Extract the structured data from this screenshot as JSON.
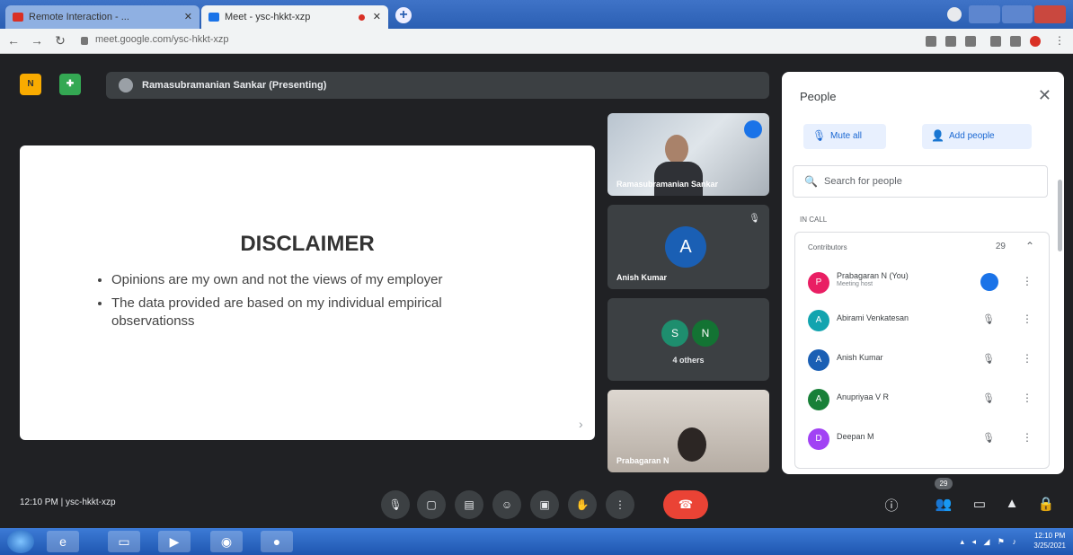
{
  "browser": {
    "tabs": [
      {
        "label": "Remote Interaction - ..."
      },
      {
        "label": "Meet - ysc-hkkt-xzp"
      }
    ],
    "url": "meet.google.com/ysc-hkkt-xzp"
  },
  "meet": {
    "presenting_label": "Ramasubramanian Sankar (Presenting)",
    "slide": {
      "title": "DISCLAIMER",
      "bullets": [
        "Opinions are my own and not the views of my employer",
        "The data provided are based on my individual empirical observationss"
      ]
    },
    "tiles": {
      "tile1_label": "Ramasubramanian Sankar",
      "tile2_initial": "A",
      "tile2_label": "Anish Kumar",
      "tile3_initial_s": "S",
      "tile3_initial_n": "N",
      "tile3_label": "4 others",
      "tile4_label": "Prabagaran N"
    },
    "bottom": {
      "time": "12:10 PM",
      "separator": "|",
      "meeting_code": "ysc-hkkt-xzp",
      "people_badge": "29"
    }
  },
  "people_panel": {
    "title": "People",
    "mute_all": "Mute all",
    "add_people": "Add people",
    "search_placeholder": "Search for people",
    "in_call": "IN CALL",
    "contributors_label": "Contributors",
    "contributors_count": "29",
    "participants": [
      {
        "initial": "P",
        "name": "Prabagaran N (You)",
        "sub": "Meeting host",
        "color": "#e91e63"
      },
      {
        "initial": "A",
        "name": "Abirami Venkatesan",
        "sub": "",
        "color": "#12a4af"
      },
      {
        "initial": "A",
        "name": "Anish Kumar",
        "sub": "",
        "color": "#1a5fb4"
      },
      {
        "initial": "A",
        "name": "Anupriyaa V R",
        "sub": "",
        "color": "#188038"
      },
      {
        "initial": "D",
        "name": "Deepan M",
        "sub": "",
        "color": "#a142f4"
      }
    ]
  },
  "taskbar": {
    "time": "12:10 PM",
    "date": "3/25/2021"
  }
}
